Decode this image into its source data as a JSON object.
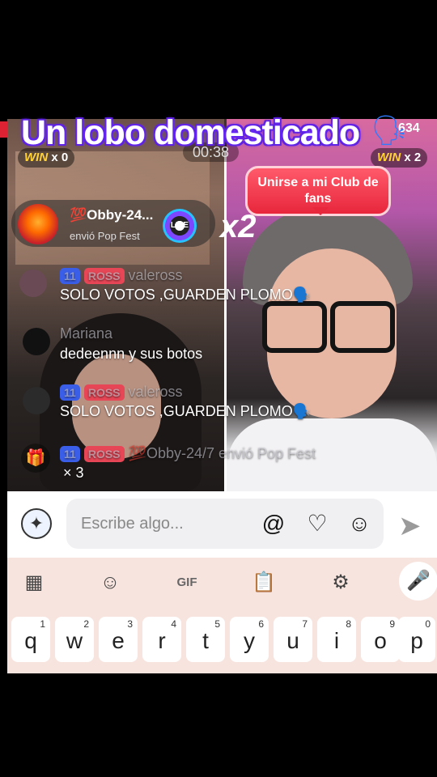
{
  "stream": {
    "title": "Un lobo domesticado",
    "viewers": "634",
    "timer": "00:38",
    "win_left": {
      "label": "WIN",
      "count": "x 0"
    },
    "win_right": {
      "label": "WIN",
      "count": "x 2"
    },
    "club_button": "Unirse a mi Club de fans",
    "gift": {
      "user": "💯Obby-24...",
      "text": "envió Pop Fest",
      "multiplier": "x2"
    }
  },
  "chat": [
    {
      "line1": "valeross",
      "badge_level": "11",
      "badge_tag": "ROSS",
      "text": "SOLO VOTOS ,GUARDEN PLOMO🗣️"
    },
    {
      "user": "Mariana",
      "text": "dedeennn y sus botos"
    },
    {
      "user": "valeross",
      "badge_level": "11",
      "badge_tag": "ROSS",
      "text": "SOLO VOTOS ,GUARDEN PLOMO🗣️"
    },
    {
      "user": "💯Obby-24/7",
      "badge_level": "11",
      "badge_tag": "ROSS",
      "text": "envió Pop Fest",
      "count": "× 3"
    }
  ],
  "input": {
    "placeholder": "Escribe algo..."
  },
  "keyboard": {
    "toolbar": {
      "gif": "GIF"
    },
    "keys": [
      {
        "char": "q",
        "num": "1"
      },
      {
        "char": "w",
        "num": "2"
      },
      {
        "char": "e",
        "num": "3"
      },
      {
        "char": "r",
        "num": "4"
      },
      {
        "char": "t",
        "num": "5"
      },
      {
        "char": "y",
        "num": "6"
      },
      {
        "char": "u",
        "num": "7"
      },
      {
        "char": "i",
        "num": "8"
      },
      {
        "char": "o",
        "num": "9"
      },
      {
        "char": "p",
        "num": "0"
      }
    ]
  },
  "colors": {
    "accent_red": "#e8263c",
    "title_glow": "#6b2dff",
    "keyboard_bg": "#f7e4de"
  }
}
